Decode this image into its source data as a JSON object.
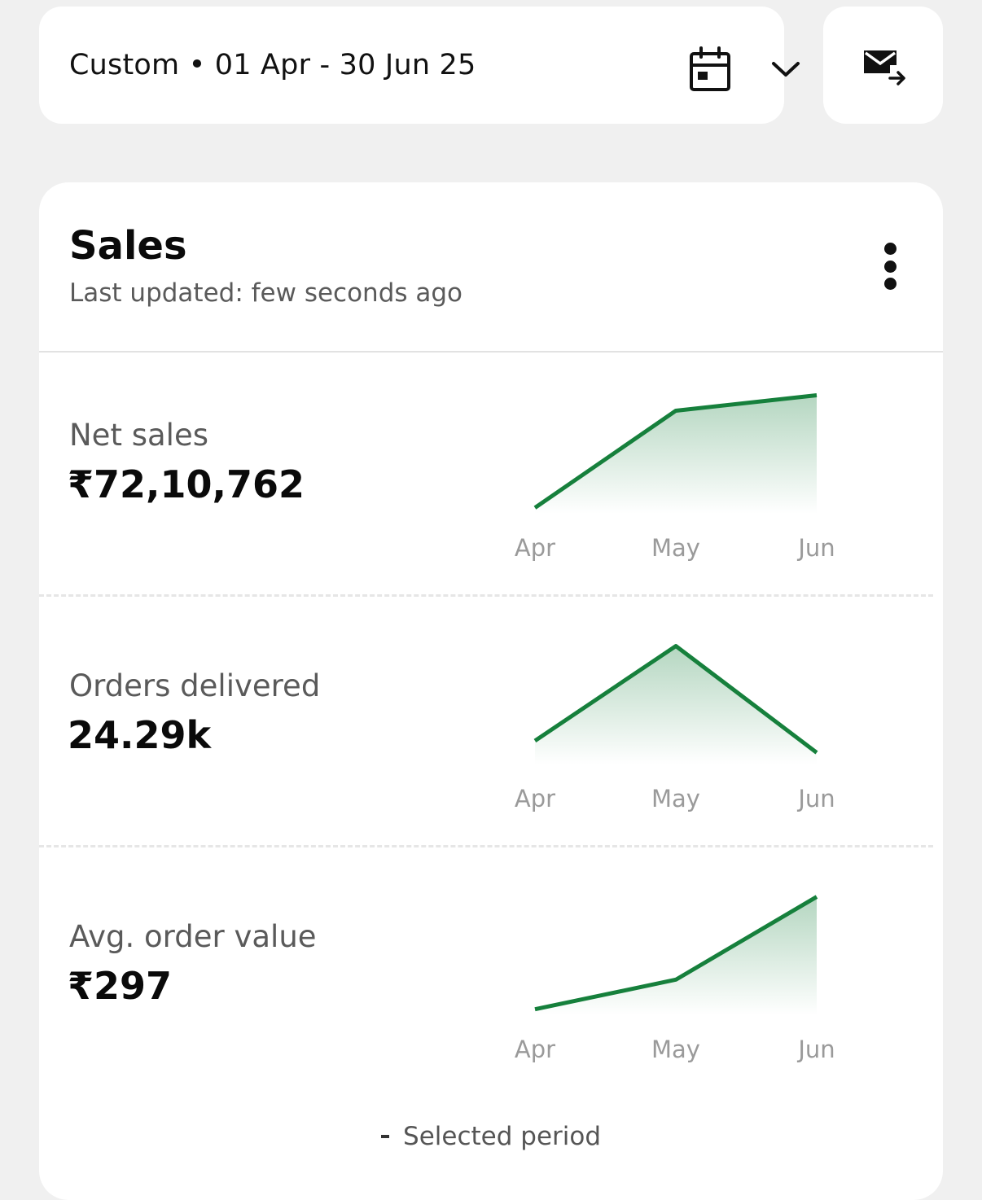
{
  "date_picker": {
    "label": "Custom • 01 Apr - 30 Jun 25",
    "calendar_icon": "calendar-icon",
    "chevron_icon": "chevron-down-icon"
  },
  "mail_button": {
    "icon": "mail-forward-icon"
  },
  "card": {
    "title": "Sales",
    "subtitle": "Last updated: few seconds ago",
    "menu_icon": "more-vertical-icon"
  },
  "metrics": [
    {
      "label": "Net sales",
      "value": "₹72,10,762",
      "chart_data": {
        "type": "area",
        "categories": [
          "Apr",
          "May",
          "Jun"
        ],
        "values": [
          0.05,
          0.87,
          1.0
        ],
        "ylim": [
          0,
          1.1
        ]
      }
    },
    {
      "label": "Orders delivered",
      "value": "24.29k",
      "chart_data": {
        "type": "area",
        "categories": [
          "Apr",
          "May",
          "Jun"
        ],
        "values": [
          0.2,
          1.0,
          0.1
        ],
        "ylim": [
          0,
          1.1
        ]
      }
    },
    {
      "label": "Avg. order value",
      "value": "₹297",
      "chart_data": {
        "type": "area",
        "categories": [
          "Apr",
          "May",
          "Jun"
        ],
        "values": [
          0.05,
          0.3,
          1.0
        ],
        "ylim": [
          0,
          1.1
        ]
      }
    }
  ],
  "legend": {
    "label": "Selected period"
  },
  "colors": {
    "line": "#16803c",
    "fill": "#16803c"
  }
}
